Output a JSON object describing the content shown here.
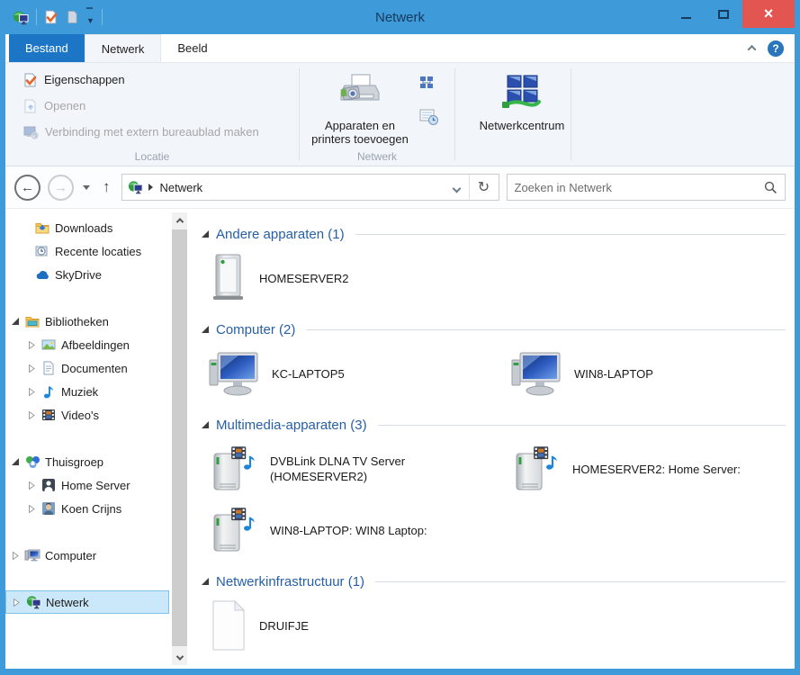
{
  "window": {
    "title": "Netwerk"
  },
  "titlebar": {
    "minimize": "–",
    "maximize": "",
    "close": "×"
  },
  "tabs": {
    "bestand": "Bestand",
    "netwerk": "Netwerk",
    "beeld": "Beeld"
  },
  "ribbon": {
    "locatie": {
      "group_label": "Locatie",
      "eigenschappen": "Eigenschappen",
      "openen": "Openen",
      "verbinding": "Verbinding met extern bureaublad maken"
    },
    "netwerk": {
      "group_label": "Netwerk",
      "apparaten": "Apparaten en printers toevoegen"
    },
    "netwerkcentrum": {
      "label": "Netwerkcentrum"
    }
  },
  "addressbar": {
    "breadcrumb": "Netwerk",
    "refresh": "↻",
    "search_placeholder": "Zoeken in Netwerk"
  },
  "sidebar": {
    "items": [
      {
        "label": "Downloads"
      },
      {
        "label": "Recente locaties"
      },
      {
        "label": "SkyDrive"
      },
      {
        "label": "Bibliotheken"
      },
      {
        "label": "Afbeeldingen"
      },
      {
        "label": "Documenten"
      },
      {
        "label": "Muziek"
      },
      {
        "label": "Video's"
      },
      {
        "label": "Thuisgroep"
      },
      {
        "label": "Home Server"
      },
      {
        "label": "Koen Crijns"
      },
      {
        "label": "Computer"
      },
      {
        "label": "Netwerk"
      }
    ]
  },
  "content": {
    "groups": [
      {
        "title": "Andere apparaten (1)",
        "items": [
          {
            "label": "HOMESERVER2"
          }
        ]
      },
      {
        "title": "Computer (2)",
        "items": [
          {
            "label": "KC-LAPTOP5"
          },
          {
            "label": "WIN8-LAPTOP"
          }
        ]
      },
      {
        "title": "Multimedia-apparaten (3)",
        "items": [
          {
            "label": "DVBLink DLNA TV Server (HOMESERVER2)"
          },
          {
            "label": "HOMESERVER2: Home Server:"
          },
          {
            "label": "WIN8-LAPTOP: WIN8 Laptop:"
          }
        ]
      },
      {
        "title": "Netwerkinfrastructuur (1)",
        "items": [
          {
            "label": "DRUIFJE"
          }
        ]
      }
    ]
  },
  "colors": {
    "titlebar": "#3f9ad9",
    "accent": "#1c76c5",
    "close_button": "#e25551",
    "group_header": "#265fa8",
    "selection": "#cbe8fa"
  }
}
